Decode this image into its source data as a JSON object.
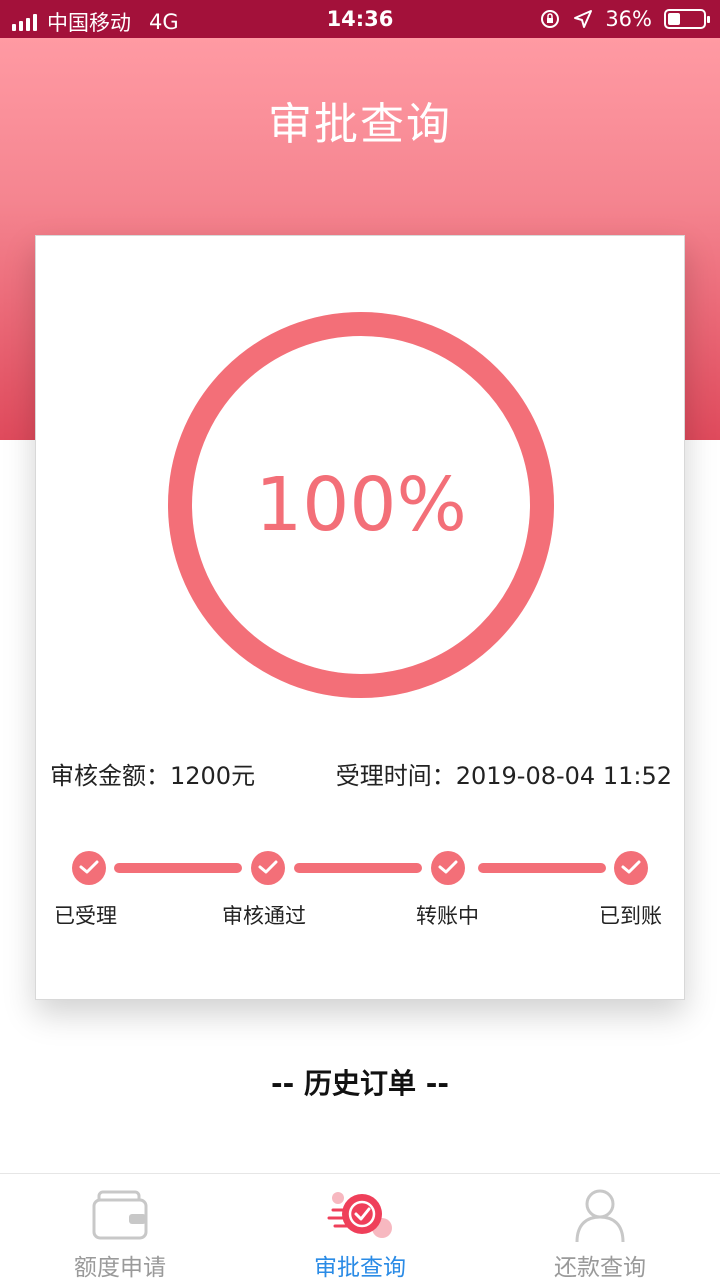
{
  "status_bar": {
    "carrier": "中国移动",
    "network": "4G",
    "time": "14:36",
    "battery": "36%",
    "battery_level": 0.36
  },
  "header": {
    "title": "审批查询"
  },
  "card": {
    "progress_percent": "100%",
    "progress_value": 1.0,
    "amount_label": "审核金额：1200元",
    "time_label": "受理时间：2019-08-04 11:52",
    "steps": [
      {
        "label": "已受理"
      },
      {
        "label": "审核通过"
      },
      {
        "label": "转账中"
      },
      {
        "label": "已到账"
      }
    ]
  },
  "history_title": "-- 历史订单 --",
  "tabbar": {
    "items": [
      {
        "label": "额度申请",
        "icon": "wallet-icon",
        "active": false
      },
      {
        "label": "审批查询",
        "icon": "approval-check-icon",
        "active": true
      },
      {
        "label": "还款查询",
        "icon": "user-icon",
        "active": false
      }
    ]
  },
  "colors": {
    "status_bar": "#a3113a",
    "accent": "#f36f78",
    "tab_active": "#2a8be6",
    "tab_inactive": "#9a9a9a"
  }
}
